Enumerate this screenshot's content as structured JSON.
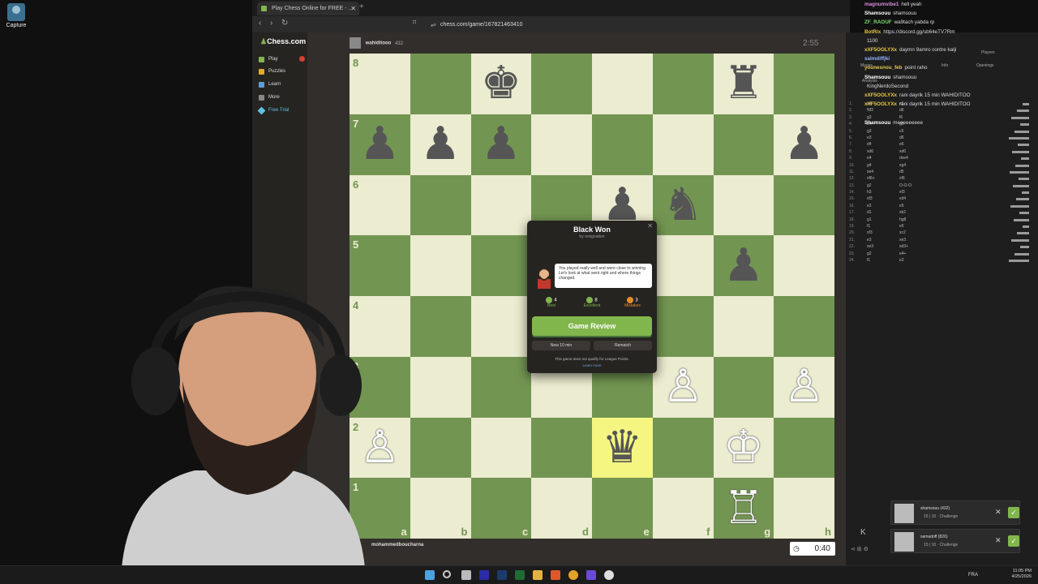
{
  "desktop": {
    "icon_label": "Capture"
  },
  "browser": {
    "tab_title": "Play Chess Online for FREE - ...",
    "url": "chess.com/game/167821463410"
  },
  "sidebar": {
    "logo": "Chess.com",
    "items": [
      {
        "label": "Play",
        "color": "#81b64c"
      },
      {
        "label": "Puzzles",
        "color": "#e3aa24"
      },
      {
        "label": "Learn",
        "color": "#5d9ed5"
      },
      {
        "label": "More",
        "color": "#888888"
      },
      {
        "label": "Free Trial",
        "color": "#5dc0e0"
      }
    ]
  },
  "players": {
    "top": {
      "name": "wahiditooo",
      "rating": "432",
      "clock": "2:55"
    },
    "bottom": {
      "name": "mohammedboucharna",
      "clock": "0:40"
    }
  },
  "board": {
    "files": [
      "a",
      "b",
      "c",
      "d",
      "e",
      "f",
      "g",
      "h"
    ],
    "ranks": [
      "8",
      "7",
      "6",
      "5",
      "4",
      "3",
      "2",
      "1"
    ],
    "pieces": [
      {
        "sq": "c8",
        "glyph": "♚",
        "side": "b"
      },
      {
        "sq": "g8",
        "glyph": "♜",
        "side": "b"
      },
      {
        "sq": "a7",
        "glyph": "♟",
        "side": "b"
      },
      {
        "sq": "b7",
        "glyph": "♟",
        "side": "b"
      },
      {
        "sq": "c7",
        "glyph": "♟",
        "side": "b"
      },
      {
        "sq": "h7",
        "glyph": "♟",
        "side": "b"
      },
      {
        "sq": "e6",
        "glyph": "♟",
        "side": "b"
      },
      {
        "sq": "f6",
        "glyph": "♞",
        "side": "b"
      },
      {
        "sq": "g5",
        "glyph": "♟",
        "side": "b"
      },
      {
        "sq": "f3",
        "glyph": "♙",
        "side": "w"
      },
      {
        "sq": "h3",
        "glyph": "♙",
        "side": "w"
      },
      {
        "sq": "a2",
        "glyph": "♙",
        "side": "w"
      },
      {
        "sq": "e2",
        "glyph": "♛",
        "side": "b"
      },
      {
        "sq": "g2",
        "glyph": "♔",
        "side": "w"
      },
      {
        "sq": "g1",
        "glyph": "♖",
        "side": "w"
      }
    ],
    "highlight": "e2"
  },
  "modal": {
    "title": "Black Won",
    "subtitle": "by resignation",
    "coach_text": "You played really well and were close to winning. Let's look at what went right and where things changed.",
    "stats": [
      {
        "value": "4",
        "label": "Best",
        "color": "#81b64c"
      },
      {
        "value": "8",
        "label": "Excellent",
        "color": "#81b64c"
      },
      {
        "value": "3",
        "label": "Mistakes",
        "color": "#e58f2a"
      }
    ],
    "review_label": "Game Review",
    "new_label": "New 10 min",
    "rematch_label": "Rematch",
    "league_note": "This game does not qualify for League Points.",
    "learn_more": "Learn more"
  },
  "right_panel": {
    "tabs": [
      "Moves",
      "Analysis",
      "Info",
      "Players",
      "Openings"
    ],
    "moves": [
      {
        "n": "1.",
        "w": "e4",
        "b": "e5"
      },
      {
        "n": "2.",
        "w": "Nf3",
        "b": "d6"
      },
      {
        "n": "3.",
        "w": "g3",
        "b": "f6"
      },
      {
        "n": "4.",
        "w": "b4",
        "b": "g5"
      },
      {
        "n": "5.",
        "w": "g3",
        "b": "c6"
      },
      {
        "n": "6.",
        "w": "e3",
        "b": "d6"
      },
      {
        "n": "7.",
        "w": "d4",
        "b": "e6"
      },
      {
        "n": "8.",
        "w": "xd6",
        "b": "xd6"
      },
      {
        "n": "9.",
        "w": "e4",
        "b": "dxe4"
      },
      {
        "n": "10.",
        "w": "g4",
        "b": "xg4"
      },
      {
        "n": "11.",
        "w": "xe4",
        "b": "d5"
      },
      {
        "n": "12.",
        "w": "xf6+",
        "b": "xf6"
      },
      {
        "n": "13.",
        "w": "g2",
        "b": "O-O-O"
      },
      {
        "n": "14.",
        "w": "h3",
        "b": "xf3"
      },
      {
        "n": "15.",
        "w": "xf3",
        "b": "xd4"
      },
      {
        "n": "16.",
        "w": "e2",
        "b": "e5"
      },
      {
        "n": "17.",
        "w": "d1",
        "b": "xb2"
      },
      {
        "n": "18.",
        "w": "g1",
        "b": "hg8"
      },
      {
        "n": "19.",
        "w": "f1",
        "b": "e5"
      },
      {
        "n": "20.",
        "w": "xf3",
        "b": "xc2"
      },
      {
        "n": "21.",
        "w": "e3",
        "b": "xe3"
      },
      {
        "n": "22.",
        "w": "xe3",
        "b": "xd3+"
      },
      {
        "n": "23.",
        "w": "g2",
        "b": "e4+"
      },
      {
        "n": "24.",
        "w": "f1",
        "b": "e2"
      }
    ]
  },
  "chat": [
    {
      "user": "magnumvibe1",
      "color": "#d98de0",
      "text": "hell yeah"
    },
    {
      "user": "Shamsouu",
      "color": "#ffffff",
      "text": "shamsouu"
    },
    {
      "user": "ZF_RAOUF",
      "color": "#7ddc6f",
      "text": "wa9tach yabda rp"
    },
    {
      "user": "BotRix",
      "color": "#e6c84a",
      "text": "https://discord.gg/sb64eTV7Rm"
    },
    {
      "user": "",
      "color": "#ffffff",
      "text": "1100"
    },
    {
      "user": "xXF5OOLYXx",
      "color": "#e6c84a",
      "text": "daymn 9amro contre kalji"
    },
    {
      "user": "salmdiffjki",
      "color": "#8fb3ff",
      "text": ""
    },
    {
      "user": "younesnou_feb",
      "color": "#e6c84a",
      "text": "point raho"
    },
    {
      "user": "Shamsouu",
      "color": "#ffffff",
      "text": "shamsouu"
    },
    {
      "user": "",
      "color": "#ffffff",
      "text": "KingNerdoSecond"
    },
    {
      "user": "xXF5OOLYXx",
      "color": "#e6c84a",
      "text": "rani dayrik 15 min WAHIDITOO"
    },
    {
      "user": "xXF5OOLYXx",
      "color": "#e6c84a",
      "text": "rani dayrik 15 min WAHIDITOO"
    },
    {
      "user": "",
      "color": "#ffffff",
      "text": ""
    },
    {
      "user": "Shamsouu",
      "color": "#ffffff",
      "text": "meeeeeeeee"
    }
  ],
  "challenges": [
    {
      "name": "shamsouu (432)",
      "meta": "15 | 10 · Challenge"
    },
    {
      "name": "samadoff (826)",
      "meta": "15 | 10 · Challenge"
    }
  ],
  "tray": {
    "lang": "FRA",
    "time": "11:05 PM",
    "date": "4/25/2026"
  }
}
